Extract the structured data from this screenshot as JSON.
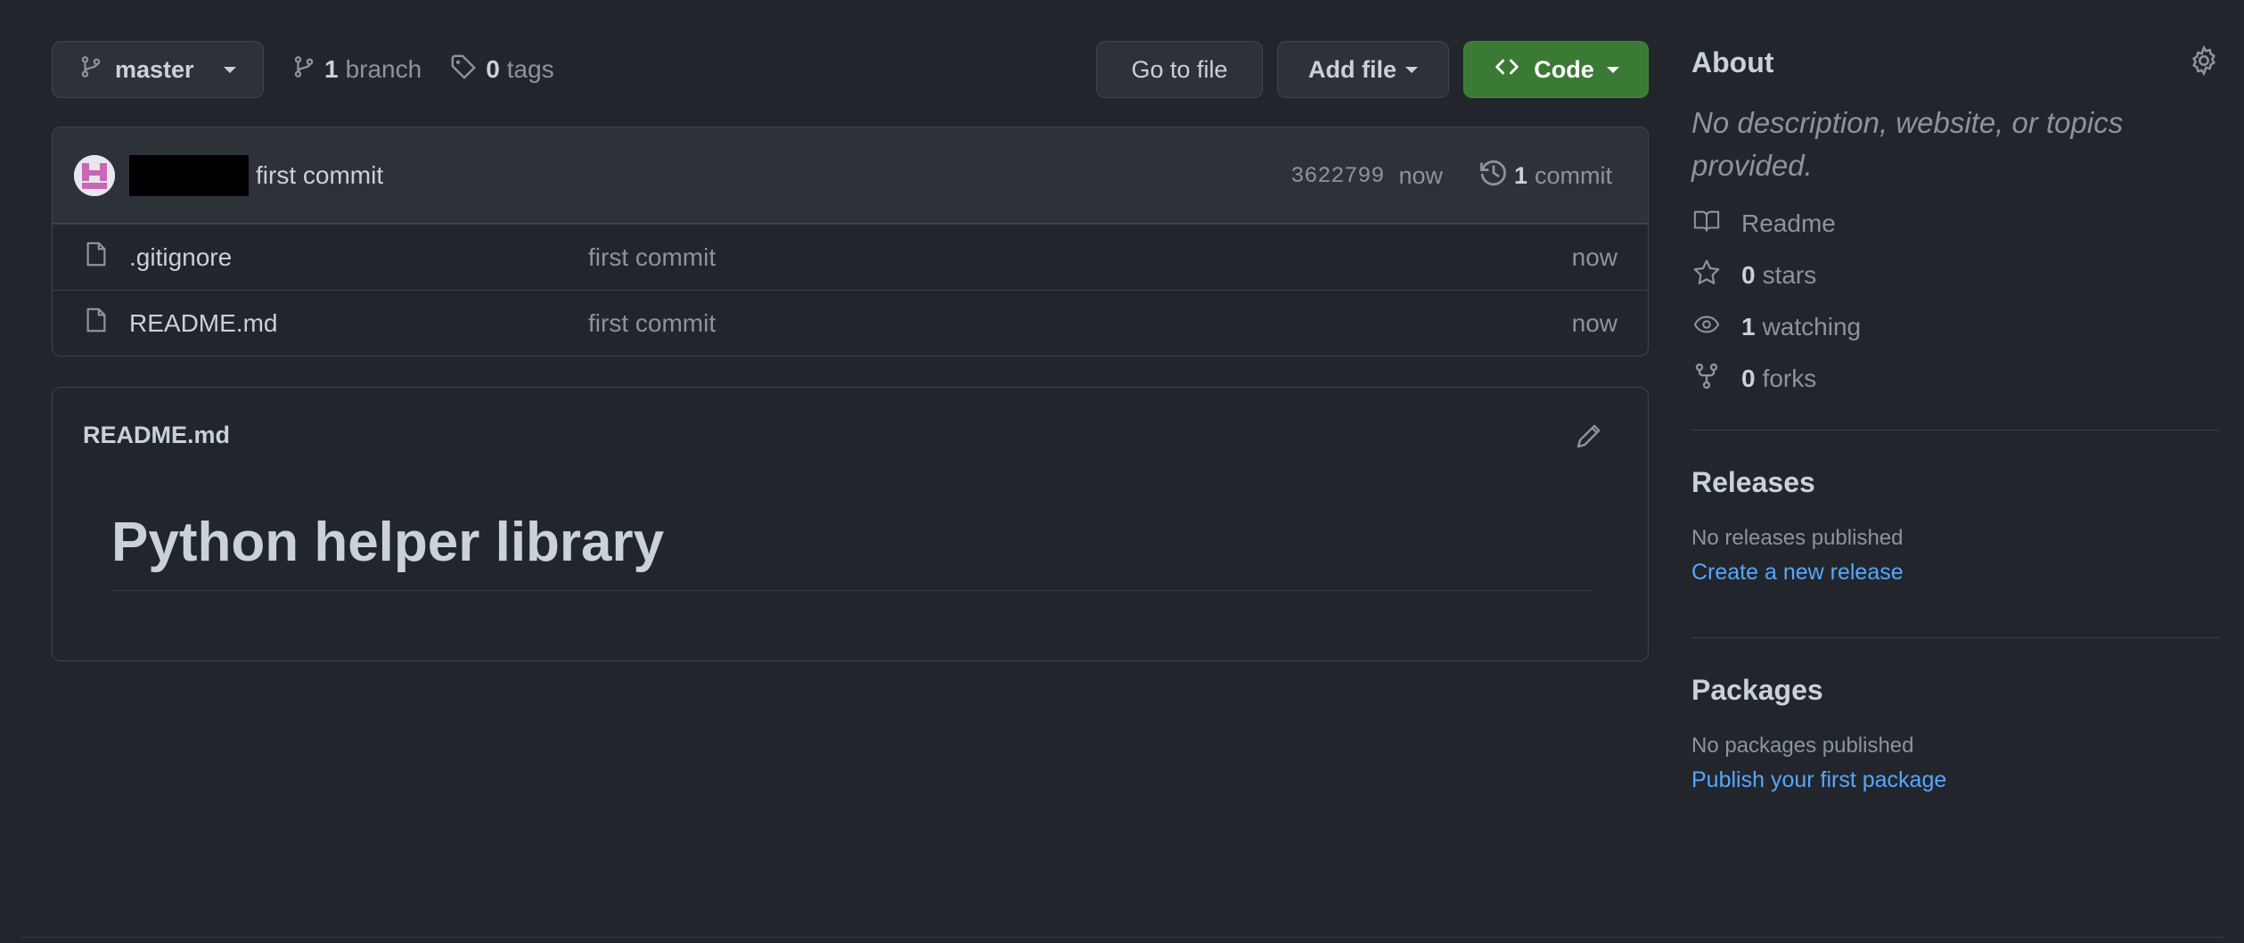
{
  "repo_bar": {
    "branch_label": "master",
    "branch_count": "1",
    "branch_word": "branch",
    "tag_count": "0",
    "tag_word": "tags",
    "goto_file_label": "Go to file",
    "add_file_label": "Add file",
    "code_label": "Code"
  },
  "latest_commit": {
    "message": "first commit",
    "sha": "3622799",
    "time": "now",
    "commit_count": "1",
    "commit_word": "commit"
  },
  "files": [
    {
      "name": ".gitignore",
      "message": "first commit",
      "time": "now"
    },
    {
      "name": "README.md",
      "message": "first commit",
      "time": "now"
    }
  ],
  "readme": {
    "filename": "README.md",
    "heading": "Python helper library"
  },
  "about": {
    "title": "About",
    "description": "No description, website, or topics provided.",
    "readme_label": "Readme",
    "stars_count": "0",
    "stars_word": "stars",
    "watching_count": "1",
    "watching_word": "watching",
    "forks_count": "0",
    "forks_word": "forks"
  },
  "releases": {
    "title": "Releases",
    "empty_text": "No releases published",
    "link": "Create a new release"
  },
  "packages": {
    "title": "Packages",
    "empty_text": "No packages published",
    "link": "Publish your first package"
  },
  "colors": {
    "background": "#22262c",
    "code_button": "#3b7a35",
    "link": "#58a6ff"
  },
  "icons": [
    "branch-icon",
    "tag-icon",
    "code-icon",
    "history-icon",
    "file-icon",
    "pencil-icon",
    "gear-icon",
    "book-icon",
    "star-icon",
    "eye-icon",
    "fork-icon"
  ]
}
